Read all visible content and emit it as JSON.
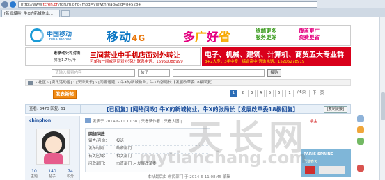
{
  "browser": {
    "url_prefix": "http://www.",
    "url_domain": "tcren.cn",
    "url_rest": "/forum.php?mod=viewthread&tid=845284",
    "tab_title": "[新闻爆料] 牛X的新城物业..."
  },
  "banner1": {
    "logo_cn": "中国移动",
    "logo_en": "China Mobile",
    "main": "移动",
    "main_4g": "4G",
    "promo_a": "多",
    "promo_b": "广",
    "promo_c": "好",
    "promo_d": "省",
    "green_1": "终端更多",
    "green_2": "服务更好",
    "pink_1": "覆盖更广",
    "pink_2": "资费更省"
  },
  "banner2": {
    "left_l1": "老移动公司对面",
    "left_l2": "房租1.7万/年",
    "left_big": "三间营业中手机店面对外转让",
    "left_sub": "可单独一间或两间对外转让 联系电话：15950088999",
    "right_title": "电子、机械、建筑、计算机、商贸五大专业群",
    "right_sub": "3+2大专，3年中专，综合高中 咨询电话：15205278919"
  },
  "search": {
    "placeholder": "请输入搜索内容",
    "select": "帖子",
    "button": "搜贴"
  },
  "breadcrumb": "› 社区 › [资讯活动区] › [天泽天长] › [同瞻话题] › 牛X的新城物业，牛X的张局长【发展改革委18楼回复】",
  "post_button": "发表新帖",
  "pager": {
    "p1": "1",
    "p2": "2",
    "p3": "3",
    "p4": "4",
    "p5": "5",
    "p6": "6",
    "page_input": "1",
    "total": "/ 6页",
    "next": "下一页"
  },
  "thread": {
    "views": "查看: 3470",
    "replies": "回复: 61",
    "tag": "[已回复]",
    "cat": "[网络问政]",
    "title": "牛X的新城物业，牛X的张局长【发展改革委18楼回复】",
    "copy_link": "[复制链接]"
  },
  "author": {
    "name": "chinphon",
    "stat1_value": "10",
    "stat1_label": "主题",
    "stat2_value": "140",
    "stat2_label": "帖子",
    "stat3_value": "74",
    "stat3_label": "积分"
  },
  "post": {
    "meta": "发表于 2014-6-10 10:38 | 只看该作者 | 只看大图 |",
    "floor": "楼主",
    "box_title": "网络问政",
    "row1_k": "留言/咨询：",
    "row1_v": "投诉",
    "row2_k": "发布时间：",
    "row2_v": "政府部门",
    "row3_k": "有关区域：",
    "row3_v": "相关部门",
    "row4_k": "问政部门：",
    "row4_v": "市直部门 > 发展改革委",
    "footer": "本帖最后由 市民部门 于 2014-6-11 08:45 编辑"
  },
  "ad": {
    "t1": "PARIS SPRING",
    "t2": "巴黎春天"
  },
  "watermark": {
    "big": "天长网",
    "small": "mytianchang.com"
  }
}
